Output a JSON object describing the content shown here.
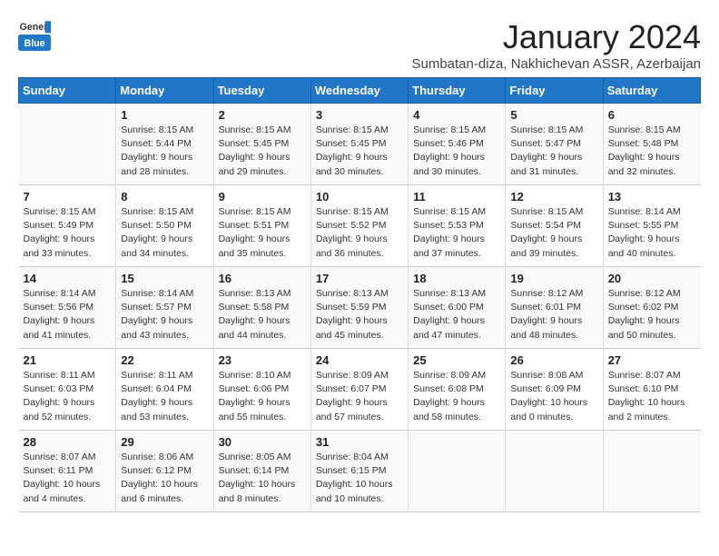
{
  "header": {
    "logo_line1": "General",
    "logo_line2": "Blue",
    "month": "January 2024",
    "location": "Sumbatan-diza, Nakhichevan ASSR, Azerbaijan"
  },
  "weekdays": [
    "Sunday",
    "Monday",
    "Tuesday",
    "Wednesday",
    "Thursday",
    "Friday",
    "Saturday"
  ],
  "weeks": [
    [
      {
        "day": "",
        "info": ""
      },
      {
        "day": "1",
        "info": "Sunrise: 8:15 AM\nSunset: 5:44 PM\nDaylight: 9 hours\nand 28 minutes."
      },
      {
        "day": "2",
        "info": "Sunrise: 8:15 AM\nSunset: 5:45 PM\nDaylight: 9 hours\nand 29 minutes."
      },
      {
        "day": "3",
        "info": "Sunrise: 8:15 AM\nSunset: 5:45 PM\nDaylight: 9 hours\nand 30 minutes."
      },
      {
        "day": "4",
        "info": "Sunrise: 8:15 AM\nSunset: 5:46 PM\nDaylight: 9 hours\nand 30 minutes."
      },
      {
        "day": "5",
        "info": "Sunrise: 8:15 AM\nSunset: 5:47 PM\nDaylight: 9 hours\nand 31 minutes."
      },
      {
        "day": "6",
        "info": "Sunrise: 8:15 AM\nSunset: 5:48 PM\nDaylight: 9 hours\nand 32 minutes."
      }
    ],
    [
      {
        "day": "7",
        "info": "Sunrise: 8:15 AM\nSunset: 5:49 PM\nDaylight: 9 hours\nand 33 minutes."
      },
      {
        "day": "8",
        "info": "Sunrise: 8:15 AM\nSunset: 5:50 PM\nDaylight: 9 hours\nand 34 minutes."
      },
      {
        "day": "9",
        "info": "Sunrise: 8:15 AM\nSunset: 5:51 PM\nDaylight: 9 hours\nand 35 minutes."
      },
      {
        "day": "10",
        "info": "Sunrise: 8:15 AM\nSunset: 5:52 PM\nDaylight: 9 hours\nand 36 minutes."
      },
      {
        "day": "11",
        "info": "Sunrise: 8:15 AM\nSunset: 5:53 PM\nDaylight: 9 hours\nand 37 minutes."
      },
      {
        "day": "12",
        "info": "Sunrise: 8:15 AM\nSunset: 5:54 PM\nDaylight: 9 hours\nand 39 minutes."
      },
      {
        "day": "13",
        "info": "Sunrise: 8:14 AM\nSunset: 5:55 PM\nDaylight: 9 hours\nand 40 minutes."
      }
    ],
    [
      {
        "day": "14",
        "info": "Sunrise: 8:14 AM\nSunset: 5:56 PM\nDaylight: 9 hours\nand 41 minutes."
      },
      {
        "day": "15",
        "info": "Sunrise: 8:14 AM\nSunset: 5:57 PM\nDaylight: 9 hours\nand 43 minutes."
      },
      {
        "day": "16",
        "info": "Sunrise: 8:13 AM\nSunset: 5:58 PM\nDaylight: 9 hours\nand 44 minutes."
      },
      {
        "day": "17",
        "info": "Sunrise: 8:13 AM\nSunset: 5:59 PM\nDaylight: 9 hours\nand 45 minutes."
      },
      {
        "day": "18",
        "info": "Sunrise: 8:13 AM\nSunset: 6:00 PM\nDaylight: 9 hours\nand 47 minutes."
      },
      {
        "day": "19",
        "info": "Sunrise: 8:12 AM\nSunset: 6:01 PM\nDaylight: 9 hours\nand 48 minutes."
      },
      {
        "day": "20",
        "info": "Sunrise: 8:12 AM\nSunset: 6:02 PM\nDaylight: 9 hours\nand 50 minutes."
      }
    ],
    [
      {
        "day": "21",
        "info": "Sunrise: 8:11 AM\nSunset: 6:03 PM\nDaylight: 9 hours\nand 52 minutes."
      },
      {
        "day": "22",
        "info": "Sunrise: 8:11 AM\nSunset: 6:04 PM\nDaylight: 9 hours\nand 53 minutes."
      },
      {
        "day": "23",
        "info": "Sunrise: 8:10 AM\nSunset: 6:06 PM\nDaylight: 9 hours\nand 55 minutes."
      },
      {
        "day": "24",
        "info": "Sunrise: 8:09 AM\nSunset: 6:07 PM\nDaylight: 9 hours\nand 57 minutes."
      },
      {
        "day": "25",
        "info": "Sunrise: 8:09 AM\nSunset: 6:08 PM\nDaylight: 9 hours\nand 58 minutes."
      },
      {
        "day": "26",
        "info": "Sunrise: 8:08 AM\nSunset: 6:09 PM\nDaylight: 10 hours\nand 0 minutes."
      },
      {
        "day": "27",
        "info": "Sunrise: 8:07 AM\nSunset: 6:10 PM\nDaylight: 10 hours\nand 2 minutes."
      }
    ],
    [
      {
        "day": "28",
        "info": "Sunrise: 8:07 AM\nSunset: 6:11 PM\nDaylight: 10 hours\nand 4 minutes."
      },
      {
        "day": "29",
        "info": "Sunrise: 8:06 AM\nSunset: 6:12 PM\nDaylight: 10 hours\nand 6 minutes."
      },
      {
        "day": "30",
        "info": "Sunrise: 8:05 AM\nSunset: 6:14 PM\nDaylight: 10 hours\nand 8 minutes."
      },
      {
        "day": "31",
        "info": "Sunrise: 8:04 AM\nSunset: 6:15 PM\nDaylight: 10 hours\nand 10 minutes."
      },
      {
        "day": "",
        "info": ""
      },
      {
        "day": "",
        "info": ""
      },
      {
        "day": "",
        "info": ""
      }
    ]
  ]
}
